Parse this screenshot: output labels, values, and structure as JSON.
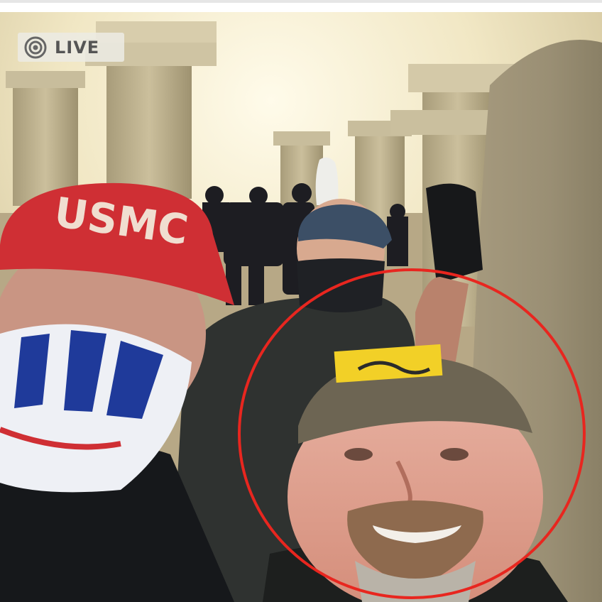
{
  "live_badge": {
    "icon": "broadcast-icon",
    "label": "LIVE"
  },
  "photo": {
    "cap_text": "USMC",
    "highlight_circle_color": "#e8261f",
    "accent_colors": {
      "cap_red": "#cf2f34",
      "patch_yellow": "#f2d027",
      "column_stone": "#b8ac8a"
    }
  }
}
